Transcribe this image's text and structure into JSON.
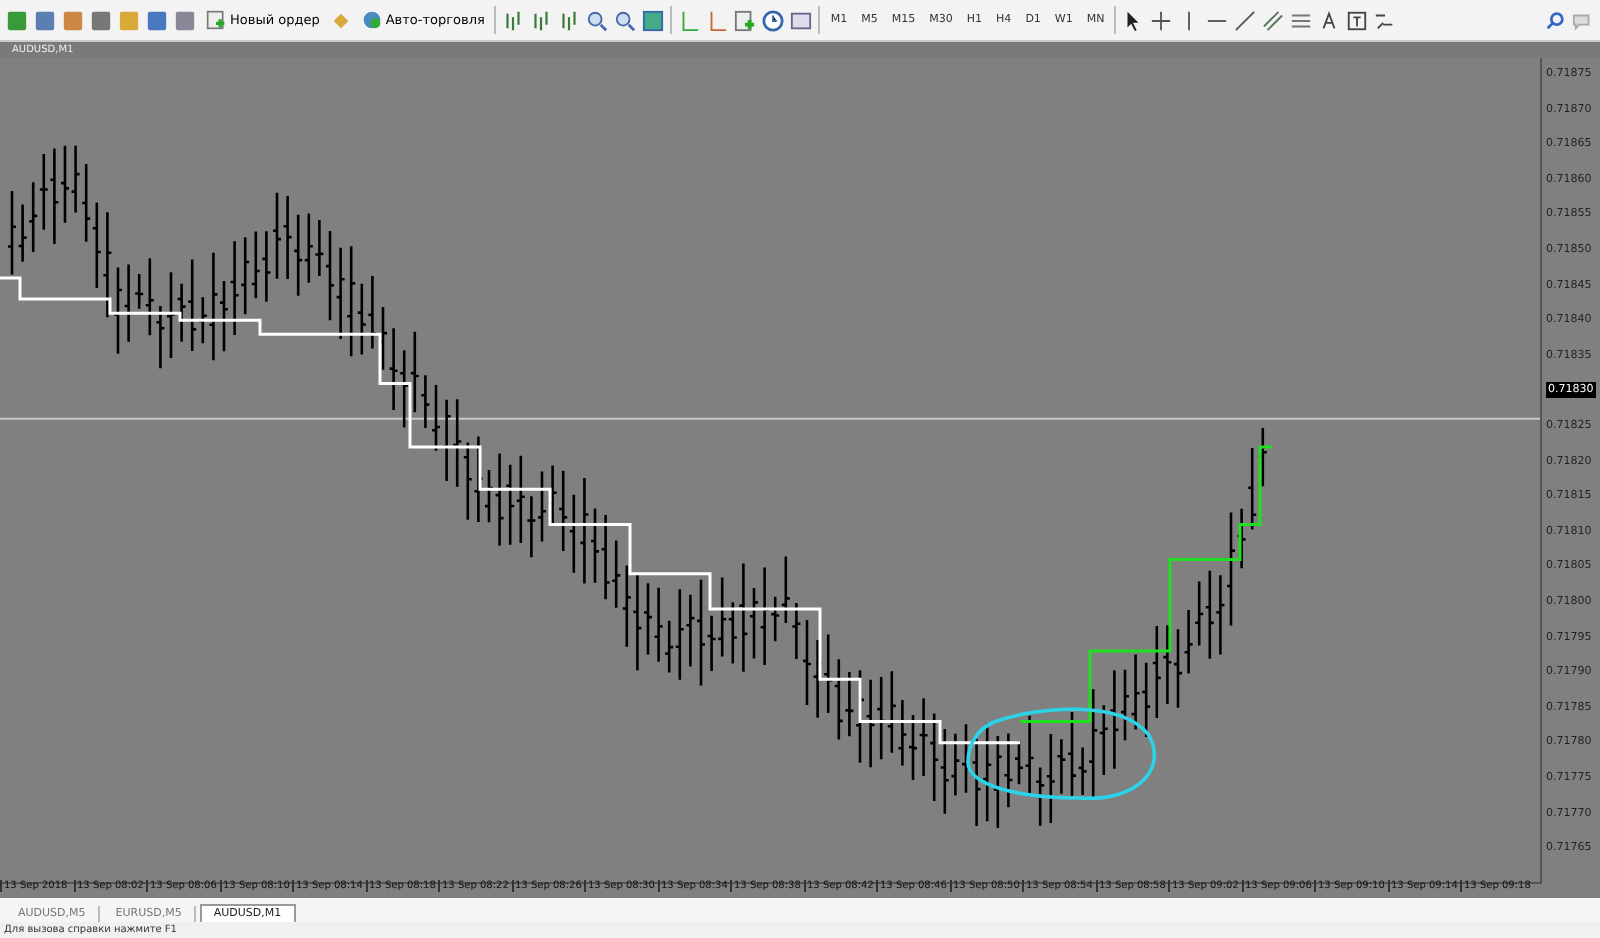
{
  "toolbar": {
    "order_button": "Новый ордер",
    "autotrade_button": "Авто-торговля",
    "timeframes": [
      "M1",
      "M5",
      "M15",
      "M30",
      "H1",
      "H4",
      "D1",
      "W1",
      "MN"
    ]
  },
  "chart": {
    "title": "AUDUSD,M1",
    "current_price": "0.71830",
    "price_labels": [
      "0.71875",
      "0.71870",
      "0.71865",
      "0.71860",
      "0.71855",
      "0.71850",
      "0.71845",
      "0.71840",
      "0.71835",
      "0.71825",
      "0.71820",
      "0.71815",
      "0.71810",
      "0.71805",
      "0.71800",
      "0.71795",
      "0.71790",
      "0.71785",
      "0.71780",
      "0.71775",
      "0.71770",
      "0.71765"
    ],
    "time_labels": [
      "13 Sep 2018",
      "13 Sep 08:02",
      "13 Sep 08:06",
      "13 Sep 08:10",
      "13 Sep 08:14",
      "13 Sep 08:18",
      "13 Sep 08:22",
      "13 Sep 08:26",
      "13 Sep 08:30",
      "13 Sep 08:34",
      "13 Sep 08:38",
      "13 Sep 08:42",
      "13 Sep 08:46",
      "13 Sep 08:50",
      "13 Sep 08:54",
      "13 Sep 08:58",
      "13 Sep 09:02",
      "13 Sep 09:06",
      "13 Sep 09:10",
      "13 Sep 09:14",
      "13 Sep 09:18"
    ]
  },
  "tabs": [
    {
      "label": "AUDUSD,M5",
      "selected": false
    },
    {
      "label": "EURUSD,M5",
      "selected": false
    },
    {
      "label": "AUDUSD,M1",
      "selected": true
    }
  ],
  "status_bar": {
    "hint": "Для вызова справки нажмите F1"
  }
}
